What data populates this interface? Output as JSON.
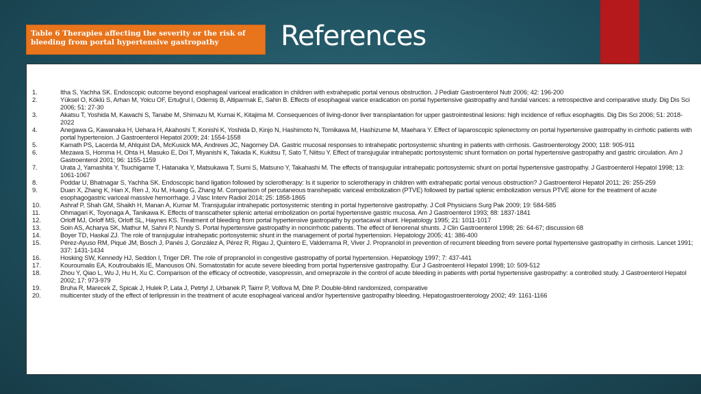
{
  "header": {
    "table_tag": "Table 6  Therapies affecting the severity or the risk of bleeding from portal hypertensive gastropathy",
    "title": "References"
  },
  "colors": {
    "background": "#1f4f5e",
    "accent_bar": "#b5191b",
    "tag_background": "#e8741c",
    "panel_background": "#ffffff"
  },
  "references": [
    {
      "num": "1.",
      "text": "Itha S, Yachha SK. Endoscopic outcome beyond esophageal variceal eradication in children with extrahepatic portal venous obstruction. J Pediatr Gastroenterol Nutr 2006; 42: 196-200"
    },
    {
      "num": "2.",
      "text": "Yüksel O, Köklü S, Arhan M, Yolcu OF, Ertuğrul I, Odemiş B, Altiparmak E, Sahin B. Effects of esophageal varice eradication on portal hypertensive gastropathy and fundal varices: a retrospective and comparative study. Dig Dis Sci 2006; 51: 27-30"
    },
    {
      "num": "3.",
      "text": "Akatsu T, Yoshida M, Kawachi S, Tanabe M, Shimazu M, Kumai K, Kitajima M. Consequences of living-donor liver transplantation for upper gastrointestinal lesions: high incidence of reflux esophagitis. Dig Dis Sci 2006; 51: 2018-2022"
    },
    {
      "num": "4.",
      "text": "Anegawa G, Kawanaka H, Uehara H, Akahoshi T, Konishi K, Yoshida D, Kinjo N, Hashimoto N, Tomikawa M, Hashizume M, Maehara Y. Effect of laparoscopic splenectomy on portal hypertensive gastropathy in cirrhotic patients with portal hypertension. J Gastroenterol Hepatol 2009; 24: 1554-1558"
    },
    {
      "num": "5.",
      "text": "Kamath PS, Lacerda M, Ahlquist DA, McKusick MA, Andrews JC, Nagorney DA. Gastric mucosal responses to intrahepatic portosystemic shunting in patients with cirrhosis. Gastroenterology 2000; 118: 905-911"
    },
    {
      "num": "6.",
      "text": "Mezawa S, Homma H, Ohta H, Masuko E, Doi T, Miyanishi K, Takada K, Kukitsu T, Sato T, Niitsu Y. Effect of transjugular intrahepatic portosystemic shunt formation on portal hypertensive gastropathy and gastric circulation. Am J Gastroenterol 2001; 96: 1155-1159"
    },
    {
      "num": "7.",
      "text": "Urata J, Yamashita Y, Tsuchigame T, Hatanaka Y, Matsukawa T, Sumi S, Matsuno Y, Takahashi M. The effects of transjugular intrahepatic portosystemic shunt on portal hypertensive gastropathy. J Gastroenterol Hepatol 1998; 13: 1061-1067"
    },
    {
      "num": "8.",
      "text": "Poddar U, Bhatnagar S, Yachha SK. Endoscopic band ligation followed by sclerotherapy: Is it superior to sclerotherapy in children with extrahepatic portal venous obstruction? J Gastroenterol Hepatol 2011; 26: 255-259"
    },
    {
      "num": "9.",
      "text": "Duan X, Zhang K, Han X, Ren J, Xu M, Huang G, Zhang M. Comparison of percutaneous transhepatic variceal embolization (PTVE) followed by partial splenic embolization versus PTVE alone for the treatment of acute esophagogastric variceal massive hemorrhage. J Vasc Interv Radiol 2014; 25: 1858-1865"
    },
    {
      "num": "10.",
      "text": "Ashraf P, Shah GM, Shaikh H, Manan A, Kumar M. Transjugular intrahepatic portosystemic stenting in portal hypertensive gastropathy. J Coll Physicians Surg Pak 2009; 19: 584-585"
    },
    {
      "num": "11.",
      "text": "Ohmagari K, Toyonaga A, Tanikawa K. Effects of transcatheter splenic arterial embolization on portal hypertensive gastric mucosa. Am J Gastroenterol 1993; 88: 1837-1841"
    },
    {
      "num": "12.",
      "text": "Orloff MJ, Orloff MS, Orloff SL, Haynes KS. Treatment of bleeding from portal hypertensive gastropathy by portacaval shunt. Hepatology 1995; 21: 1011-1017"
    },
    {
      "num": "13.",
      "text": "Soin AS, Acharya SK, Mathur M, Sahni P, Nundy S. Portal hypertensive gastropathy in noncirrhotic patients. The effect of lienorenal shunts. J Clin Gastroenterol 1998; 26: 64-67; discussion 68"
    },
    {
      "num": "14.",
      "text": "Boyer TD, Haskal ZJ. The role of transjugular intrahepatic portosystemic shunt in the management of portal hypertension. Hepatology 2005; 41: 386-400"
    },
    {
      "num": "15.",
      "text": "Pérez-Ayuso RM, Piqué JM, Bosch J, Panés J, González A, Pérez R, Rigau J, Quintero E, Valderrama R, Viver J. Propranolol in prevention of recurrent bleeding from severe portal hypertensive gastropathy in cirrhosis. Lancet 1991; 337: 1431-1434"
    },
    {
      "num": "16.",
      "text": "Hosking SW, Kennedy HJ, Seddon I, Triger DR. The role of propranolol in congestive gastropathy of portal hypertension. Hepatology 1997; 7: 437-441"
    },
    {
      "num": "17.",
      "text": "Kouroumalis EA, Koutroubakis IE, Manousos ON. Somatostatin for acute severe bleeding from portal hypertensive gastropathy. Eur J Gastroenterol Hepatol 1998; 10: 509-512"
    },
    {
      "num": "18.",
      "text": "Zhou Y, Qiao L, Wu J, Hu H, Xu C. Comparison of the efficacy of octreotide, vasopressin, and omeprazole in the control of acute bleeding in patients with portal hypertensive gastropathy: a controlled study. J Gastroenterol Hepatol 2002; 17: 973-979"
    },
    {
      "num": "19.",
      "text": "Bruha R, Marecek Z, Spicak J, Hulek P, Lata J, Petrtyl J, Urbanek P, Taimr P, Volfova M, Dite P. Double-blind randomized, comparative"
    },
    {
      "num": "20.",
      "text": "multicenter study of the effect of terlipressin in the treatment of acute esophageal variceal and/or hypertensive gastropathy bleeding. Hepatogastroenterology 2002; 49: 1161-1166"
    }
  ]
}
